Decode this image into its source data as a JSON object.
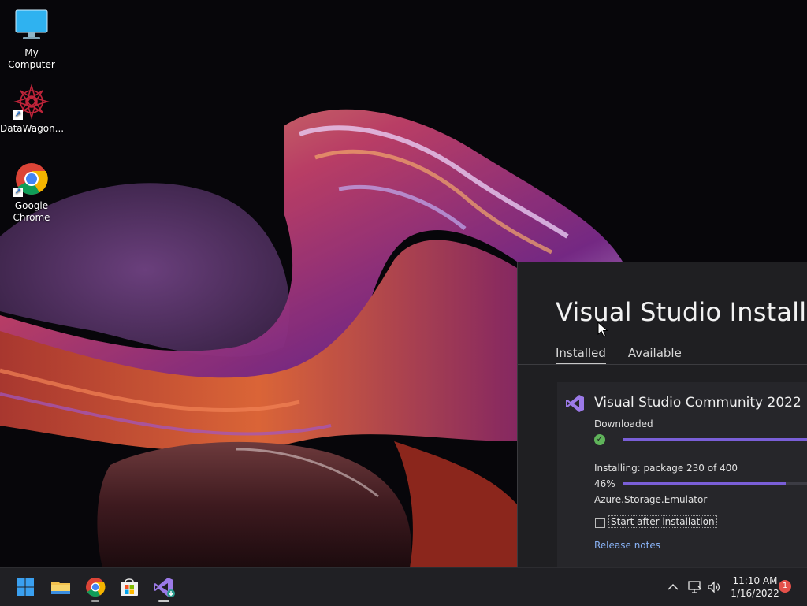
{
  "desktop": {
    "icons": [
      {
        "label": "My Computer",
        "icon": "monitor-icon"
      },
      {
        "label": "DataWagon...",
        "icon": "mandala-logo-icon"
      },
      {
        "label": "Google Chrome",
        "icon": "chrome-icon"
      }
    ]
  },
  "installer": {
    "title": "Visual Studio Installer",
    "tabs": [
      {
        "label": "Installed",
        "active": true
      },
      {
        "label": "Available",
        "active": false
      }
    ],
    "product": {
      "name": "Visual Studio Community 2022",
      "download_status": "Downloaded",
      "download_progress": 1.0,
      "install_status": "Installing: package 230 of 400",
      "install_percent": "46%",
      "install_progress": 0.46,
      "current_package": "Azure.Storage.Emulator",
      "start_after_label": "Start after installation",
      "start_after_checked": false,
      "release_notes": "Release notes"
    }
  },
  "taskbar": {
    "apps": [
      "windows-start-icon",
      "file-explorer-icon",
      "chrome-icon",
      "microsoft-store-icon",
      "visual-studio-installer-icon"
    ],
    "tray": [
      "chevron-up-icon",
      "network-icon",
      "speaker-icon"
    ],
    "clock_time": "11:10 AM",
    "clock_date": "1/16/2022",
    "notification_count": "1"
  },
  "colors": {
    "accent": "#7a5fd8",
    "success": "#5fb35a",
    "link": "#8ab4f8",
    "badge": "#e4504a"
  }
}
